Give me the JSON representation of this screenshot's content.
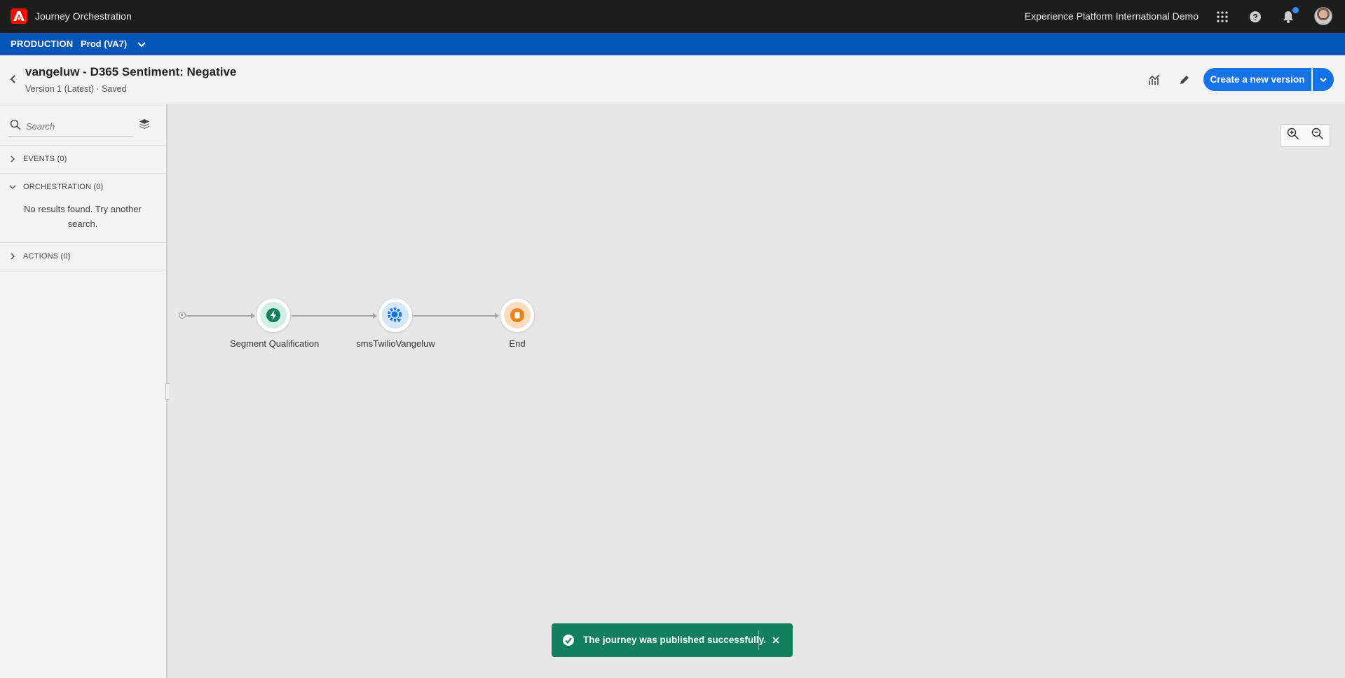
{
  "topbar": {
    "app_title": "Journey Orchestration",
    "org_name": "Experience Platform International Demo",
    "icons": [
      "adobe-logo",
      "apps-grid-icon",
      "help-icon",
      "bell-icon",
      "avatar"
    ]
  },
  "envbar": {
    "environment": "PRODUCTION",
    "sandbox": "Prod (VA7)"
  },
  "header": {
    "journey_name": "vangeluw - D365 Sentiment: Negative",
    "journey_meta": "Version 1 (Latest) · Saved",
    "create_version_label": "Create a new version"
  },
  "palette": {
    "search_placeholder": "Search",
    "sections": [
      {
        "label": "EVENTS (0)",
        "expanded": false
      },
      {
        "label": "ORCHESTRATION (0)",
        "expanded": true,
        "empty_text": "No results found. Try another search."
      },
      {
        "label": "ACTIONS (0)",
        "expanded": false
      }
    ]
  },
  "canvas": {
    "nodes": [
      {
        "label": "Segment Qualification",
        "icon": "lightning-icon",
        "color": "#12805c",
        "bg": "#d2efe3"
      },
      {
        "label": "smsTwilioVangeluw",
        "icon": "custom-action-gear-icon",
        "color": "#1473e6",
        "bg": "#d6e6fb"
      },
      {
        "label": "End",
        "icon": "stop-icon",
        "color": "#e68619",
        "bg": "#fbdcc0"
      }
    ]
  },
  "toast": {
    "message": "The journey was published successfully."
  },
  "colors": {
    "topbar": "#1d1d1d",
    "envbar": "#0457b8",
    "primary_button": "#1473e6",
    "toast_success": "#12805c"
  }
}
